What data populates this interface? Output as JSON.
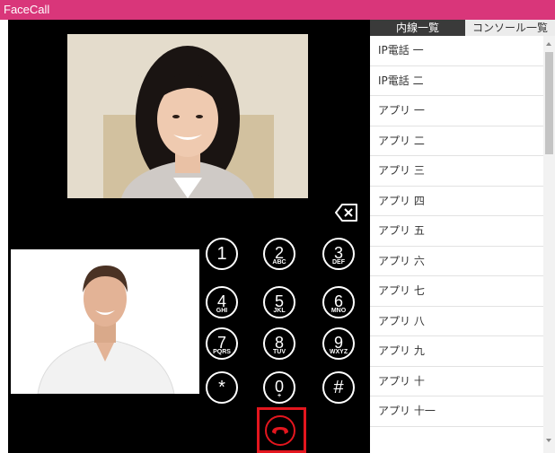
{
  "app": {
    "title": "FaceCall",
    "title_bar_color": "#d9367a"
  },
  "dialpad": {
    "keys": [
      {
        "digit": "1",
        "letters": ""
      },
      {
        "digit": "2",
        "letters": "ABC"
      },
      {
        "digit": "3",
        "letters": "DEF"
      },
      {
        "digit": "4",
        "letters": "GHI"
      },
      {
        "digit": "5",
        "letters": "JKL"
      },
      {
        "digit": "6",
        "letters": "MNO"
      },
      {
        "digit": "7",
        "letters": "PQRS"
      },
      {
        "digit": "8",
        "letters": "TUV"
      },
      {
        "digit": "9",
        "letters": "WXYZ"
      },
      {
        "digit": "*",
        "letters": ""
      },
      {
        "digit": "0",
        "letters": "+"
      },
      {
        "digit": "#",
        "letters": ""
      }
    ],
    "backspace_icon": "backspace-icon",
    "hangup_icon": "hangup-icon",
    "hangup_color": "#e3161e"
  },
  "tabs": [
    {
      "label": "内線一覧",
      "active": true
    },
    {
      "label": "コンソール一覧",
      "active": false
    }
  ],
  "extensions": [
    "IP電話 一",
    "IP電話 二",
    "アプリ 一",
    "アプリ 二",
    "アプリ 三",
    "アプリ 四",
    "アプリ 五",
    "アプリ 六",
    "アプリ 七",
    "アプリ 八",
    "アプリ 九",
    "アプリ 十",
    "アプリ 十一"
  ]
}
